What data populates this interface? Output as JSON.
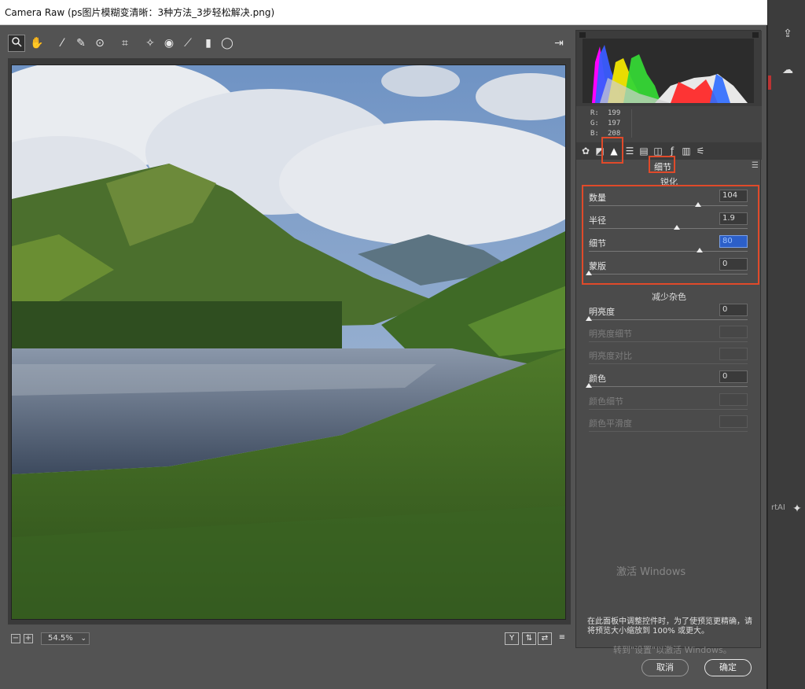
{
  "window": {
    "title": "Camera Raw (ps图片模糊变清晰：3种方法_3步轻松解决.png)"
  },
  "toolbar": {
    "tools": [
      "zoom-tool",
      "hand-tool",
      "white-balance-tool",
      "color-sampler-tool",
      "target-adjust-tool",
      "crop-tool",
      "straighten-tool",
      "spot-removal-tool",
      "red-eye-tool",
      "adjustment-brush",
      "graduated-filter",
      "radial-filter"
    ],
    "open_preferences": "open-in-new-icon"
  },
  "status": {
    "zoom": "54.5%",
    "zoom_minus": "−",
    "zoom_plus": "+",
    "view_y": "Y",
    "view_swap": "⇅",
    "view_copy": "⇄",
    "view_settings": "≡"
  },
  "info": {
    "r_label": "R:",
    "r": "199",
    "g_label": "G:",
    "g": "197",
    "b_label": "B:",
    "b": "208"
  },
  "panel": {
    "title": "细节",
    "sharpen": {
      "title": "锐化",
      "amount": {
        "label": "数量",
        "value": "104",
        "level": 0.7
      },
      "radius": {
        "label": "半径",
        "value": "1.9",
        "level": 0.55
      },
      "detail": {
        "label": "细节",
        "value": "80",
        "level": 0.72
      },
      "masking": {
        "label": "蒙版",
        "value": "0",
        "level": 0.0
      }
    },
    "noise": {
      "title": "减少杂色",
      "luminance": {
        "label": "明亮度",
        "value": "0",
        "level": 0.0
      },
      "luminance_detail": {
        "label": "明亮度细节",
        "value": ""
      },
      "luminance_contrast": {
        "label": "明亮度对比",
        "value": ""
      },
      "color": {
        "label": "颜色",
        "value": "0",
        "level": 0.0
      },
      "color_detail": {
        "label": "颜色细节",
        "value": ""
      },
      "color_smoothness": {
        "label": "颜色平滑度",
        "value": ""
      }
    },
    "note": "在此面板中调整控件时，为了使预览更精确，请将预览大小缩放到 100% 或更大。"
  },
  "buttons": {
    "cancel": "取消",
    "ok": "确定"
  },
  "watermark": {
    "line1": "激活 Windows",
    "line2": "转到\"设置\"以激活 Windows。"
  },
  "host": {
    "side_label": "rtAI"
  },
  "colors": {
    "highlight": "#e04a2a",
    "selection": "#2c5fc8"
  }
}
